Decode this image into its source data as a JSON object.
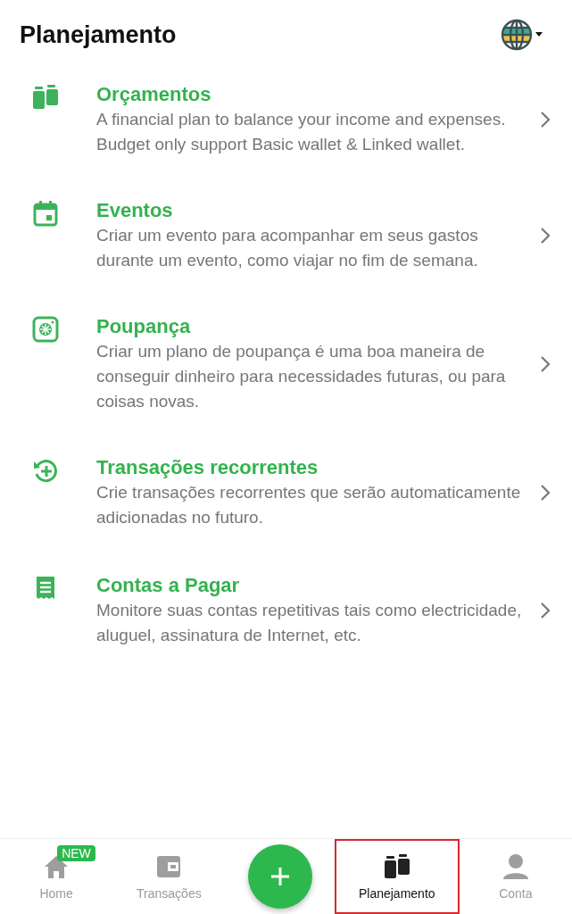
{
  "header": {
    "title": "Planejamento"
  },
  "items": [
    {
      "kind": "budget",
      "title": "Orçamentos",
      "description": [
        "A financial plan to balance your income and expenses.",
        "Budget only support Basic wallet & Linked wallet."
      ]
    },
    {
      "kind": "event",
      "title": "Eventos",
      "description": [
        "Criar um evento para acompanhar em seus gastos durante um evento, como viajar no fim de semana."
      ]
    },
    {
      "kind": "saving",
      "title": "Poupança",
      "description": [
        "Criar um plano de poupança é uma boa maneira de conseguir dinheiro para necessidades futuras, ou para coisas novas."
      ]
    },
    {
      "kind": "recurring",
      "title": "Transações recorrentes",
      "description": [
        "Crie transações recorrentes que serão automaticamente adicionadas no futuro."
      ]
    },
    {
      "kind": "bills",
      "title": "Contas a Pagar",
      "description": [
        "Monitore suas contas repetitivas tais como electricidade, aluguel, assinatura de Internet, etc."
      ]
    }
  ],
  "bottom_nav": [
    {
      "kind": "home",
      "label": "Home",
      "badge": "NEW",
      "selected": false
    },
    {
      "kind": "wallet",
      "label": "Transações",
      "selected": false
    },
    {
      "kind": "add",
      "selected": false
    },
    {
      "kind": "planning",
      "label": "Planejamento",
      "selected": true,
      "highlighted": true
    },
    {
      "kind": "account",
      "label": "Conta",
      "selected": false
    }
  ]
}
